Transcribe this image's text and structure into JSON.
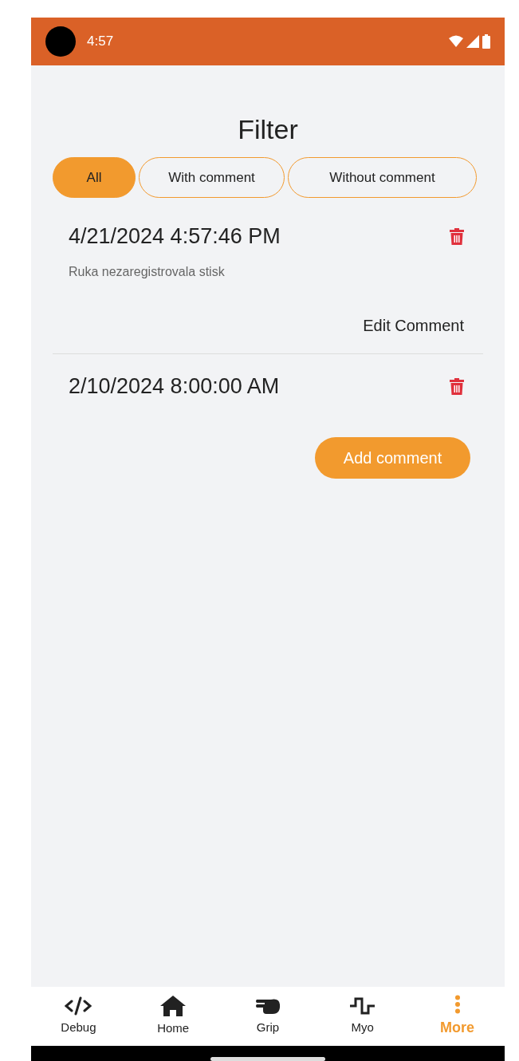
{
  "status_bar": {
    "time": "4:57"
  },
  "title": "Filter",
  "filters": [
    {
      "label": "All",
      "selected": true
    },
    {
      "label": "With comment",
      "selected": false
    },
    {
      "label": "Without comment",
      "selected": false
    }
  ],
  "entries": [
    {
      "date": "4/21/2024 4:57:46 PM",
      "comment": "Ruka nezaregistrovala stisk",
      "action": "Edit Comment"
    },
    {
      "date": "2/10/2024 8:00:00 AM"
    }
  ],
  "add_button": "Add comment",
  "nav": [
    {
      "kind": "code",
      "label": "Debug",
      "selected": false
    },
    {
      "kind": "home",
      "label": "Home",
      "selected": false
    },
    {
      "kind": "grip",
      "label": "Grip",
      "selected": false
    },
    {
      "kind": "myo",
      "label": "Myo",
      "selected": false
    },
    {
      "kind": "more",
      "label": "More",
      "selected": true
    }
  ]
}
